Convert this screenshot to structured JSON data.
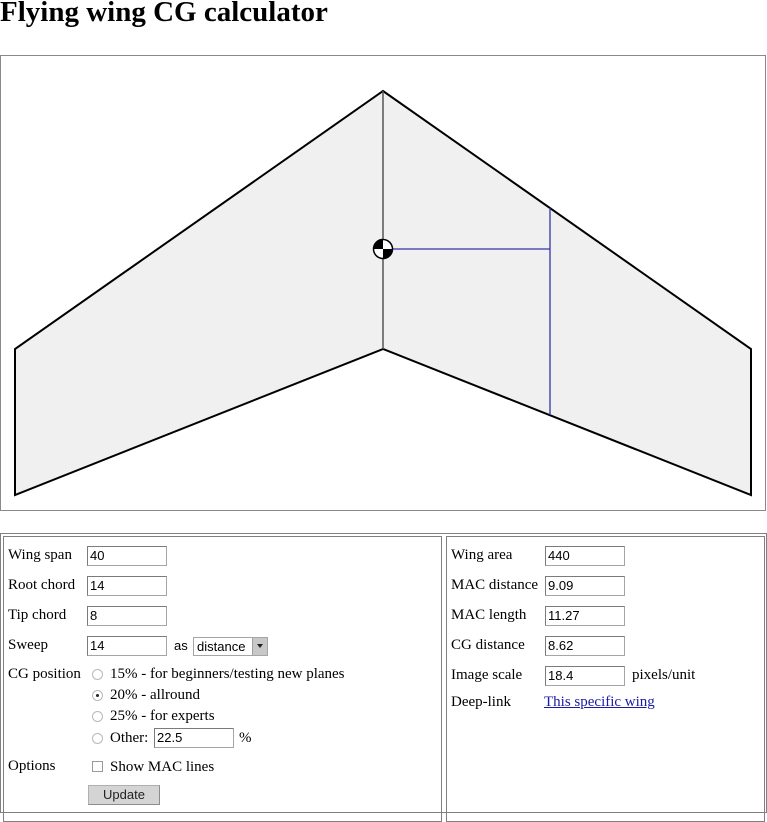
{
  "page": {
    "title": "Flying wing CG calculator"
  },
  "drawing": {
    "colors": {
      "wing_fill": "#f0f0f0",
      "outline": "#000000",
      "centerline": "#555555",
      "mac_line": "#3333aa"
    },
    "wing_geometry_units": {
      "span": 40,
      "root_chord": 14,
      "tip_chord": 8,
      "sweep": 14
    },
    "cg_marker": "cg-symbol-icon"
  },
  "inputs": {
    "wing_span": {
      "label": "Wing span",
      "value": "40"
    },
    "root_chord": {
      "label": "Root chord",
      "value": "14"
    },
    "tip_chord": {
      "label": "Tip chord",
      "value": "8"
    },
    "sweep": {
      "label": "Sweep",
      "value": "14",
      "as_label": "as",
      "mode_selected": "distance"
    },
    "cg_position": {
      "label": "CG position",
      "options": [
        {
          "label": "15% - for beginners/testing new planes",
          "checked": false
        },
        {
          "label": "20% - allround",
          "checked": true
        },
        {
          "label": "25% - for experts",
          "checked": false
        },
        {
          "label": "Other:",
          "checked": false
        }
      ],
      "other_value": "22.5",
      "other_unit": "%"
    },
    "options": {
      "label": "Options",
      "show_mac_lines_label": "Show MAC lines",
      "show_mac_lines_checked": false
    },
    "update_button": "Update"
  },
  "results": {
    "wing_area": {
      "label": "Wing area",
      "value": "440"
    },
    "mac_distance": {
      "label": "MAC distance",
      "value": "9.09"
    },
    "mac_length": {
      "label": "MAC length",
      "value": "11.27"
    },
    "cg_distance": {
      "label": "CG distance",
      "value": "8.62"
    },
    "image_scale": {
      "label": "Image scale",
      "value": "18.4",
      "unit": "pixels/unit"
    },
    "deep_link": {
      "label": "Deep-link",
      "link_text": "This specific wing"
    }
  }
}
